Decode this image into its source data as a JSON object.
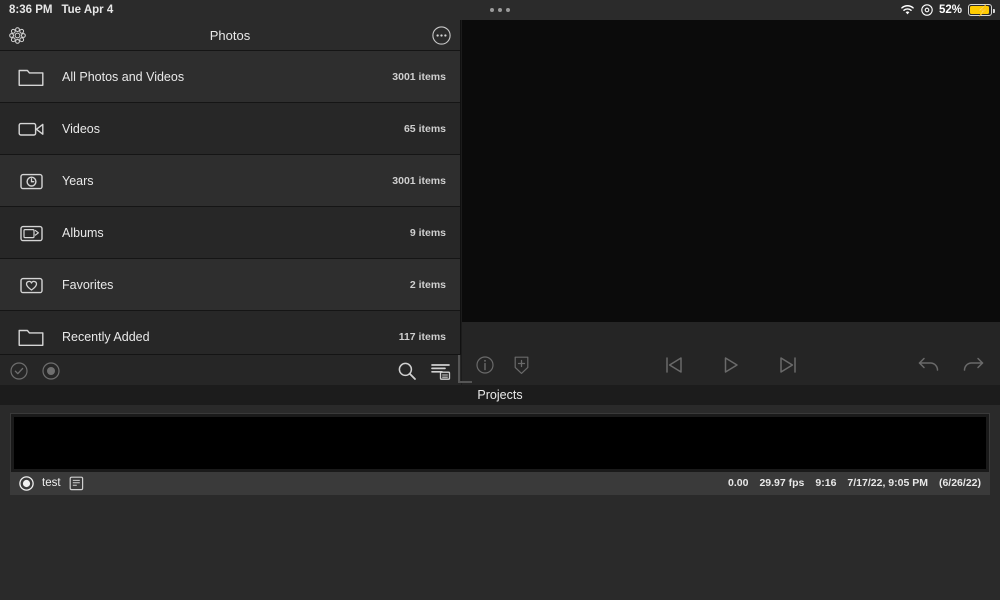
{
  "statusbar": {
    "time": "8:36 PM",
    "date": "Tue Apr 4",
    "battery_percent": "52%",
    "wifi_icon": "wifi-icon",
    "location_icon": "location-icon",
    "battery_icon": "battery-charging-icon",
    "multitask_icon": "multitask-dots-icon"
  },
  "photos_panel": {
    "header": {
      "title": "Photos",
      "left_icon": "aperture-flower-icon",
      "more_icon": "more-ellipsis-circle-icon"
    },
    "rows": [
      {
        "label": "All Photos and Videos",
        "count": "3001 items",
        "icon": "folder-icon"
      },
      {
        "label": "Videos",
        "count": "65 items",
        "icon": "video-camera-icon"
      },
      {
        "label": "Years",
        "count": "3001 items",
        "icon": "clock-frame-icon"
      },
      {
        "label": "Albums",
        "count": "9 items",
        "icon": "photo-stack-icon"
      },
      {
        "label": "Favorites",
        "count": "2 items",
        "icon": "heart-frame-icon"
      },
      {
        "label": "Recently Added",
        "count": "117 items",
        "icon": "folder-icon"
      }
    ],
    "toolbar": {
      "select_icon": "checkmark-circle-icon",
      "record_icon": "record-circle-icon",
      "search_icon": "search-icon",
      "view_mode_icon": "list-view-icon"
    }
  },
  "viewer_toolbar": {
    "info_icon": "info-circle-icon",
    "badge_icon": "shield-plus-icon",
    "previous_icon": "skip-previous-icon",
    "play_icon": "play-icon",
    "next_icon": "skip-next-icon",
    "undo_icon": "undo-arrow-icon",
    "redo_icon": "redo-arrow-icon"
  },
  "projects": {
    "title": "Projects",
    "items": [
      {
        "name": "test",
        "selected_icon": "radio-selected-icon",
        "doc_icon": "document-icon",
        "meta": {
          "position": "0.00",
          "fps": "29.97 fps",
          "aspect": "9:16",
          "modified": "7/17/22, 9:05 PM",
          "created": "(6/26/22)"
        }
      }
    ]
  },
  "colors": {
    "accent_yellow": "#ffcc00",
    "panel_bg": "#2e2e2e",
    "window_bg": "#1c1c1c"
  }
}
